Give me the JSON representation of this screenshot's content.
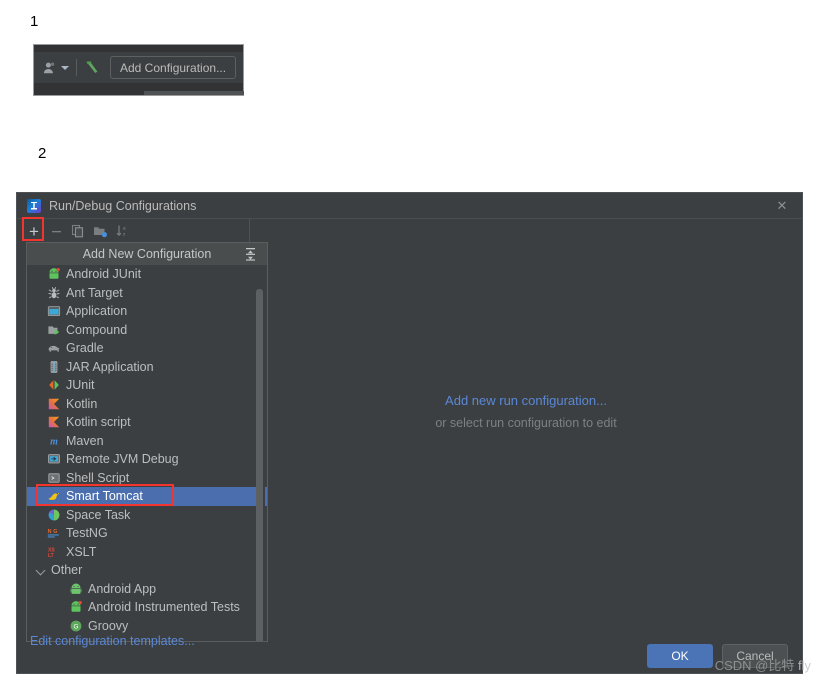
{
  "steps": {
    "one": "1",
    "two": "2"
  },
  "toolbar": {
    "profile_icon": "user-dropdown-icon",
    "build_icon": "hammer-icon",
    "add_configuration_label": "Add Configuration..."
  },
  "dialog": {
    "title": "Run/Debug Configurations",
    "logo_icon": "intellij-idea-logo-icon",
    "close_icon": "close-icon",
    "toolbar_buttons": [
      {
        "name": "add-configuration-button",
        "icon": "plus-icon",
        "glyph": "+",
        "enabled": true
      },
      {
        "name": "remove-configuration-button",
        "icon": "minus-icon",
        "glyph": "–",
        "enabled": false
      },
      {
        "name": "copy-configuration-button",
        "icon": "copy-icon",
        "glyph": "",
        "enabled": false
      },
      {
        "name": "save-configuration-button",
        "icon": "folder-save-icon",
        "glyph": "",
        "enabled": false
      },
      {
        "name": "sort-configurations-button",
        "icon": "sort-alphabetically-icon",
        "glyph": "",
        "enabled": false
      }
    ],
    "center": {
      "link": "Add new run configuration...",
      "hint": "or select run configuration to edit"
    },
    "buttons": [
      {
        "label": "OK",
        "primary": true
      },
      {
        "label": "Cancel",
        "primary": false
      }
    ]
  },
  "popup": {
    "header": "Add New Configuration",
    "header_icon": "expand-collapse-icon",
    "templates_link": "Edit configuration templates...",
    "items": [
      {
        "label": "Android JUnit",
        "icon": "android-junit-icon",
        "type": "item",
        "selected": false
      },
      {
        "label": "Ant Target",
        "icon": "ant-icon",
        "type": "item",
        "selected": false
      },
      {
        "label": "Application",
        "icon": "application-window-icon",
        "type": "item",
        "selected": false
      },
      {
        "label": "Compound",
        "icon": "compound-icon",
        "type": "item",
        "selected": false
      },
      {
        "label": "Gradle",
        "icon": "gradle-elephant-icon",
        "type": "item",
        "selected": false
      },
      {
        "label": "JAR Application",
        "icon": "jar-icon",
        "type": "item",
        "selected": false
      },
      {
        "label": "JUnit",
        "icon": "junit-icon",
        "type": "item",
        "selected": false
      },
      {
        "label": "Kotlin",
        "icon": "kotlin-icon",
        "type": "item",
        "selected": false
      },
      {
        "label": "Kotlin script",
        "icon": "kotlin-icon",
        "type": "item",
        "selected": false
      },
      {
        "label": "Maven",
        "icon": "maven-icon",
        "type": "item",
        "selected": false
      },
      {
        "label": "Remote JVM Debug",
        "icon": "remote-debug-icon",
        "type": "item",
        "selected": false
      },
      {
        "label": "Shell Script",
        "icon": "shell-script-icon",
        "type": "item",
        "selected": false
      },
      {
        "label": "Smart Tomcat",
        "icon": "tomcat-icon",
        "type": "item",
        "selected": true
      },
      {
        "label": "Space Task",
        "icon": "space-task-icon",
        "type": "item",
        "selected": false
      },
      {
        "label": "TestNG",
        "icon": "testng-icon",
        "type": "item",
        "selected": false
      },
      {
        "label": "XSLT",
        "icon": "xslt-icon",
        "type": "item",
        "selected": false
      },
      {
        "label": "Other",
        "icon": "chevron-down-icon",
        "type": "group",
        "selected": false
      },
      {
        "label": "Android App",
        "icon": "android-icon",
        "type": "child",
        "selected": false
      },
      {
        "label": "Android Instrumented Tests",
        "icon": "android-junit-icon",
        "type": "child",
        "selected": false
      },
      {
        "label": "Groovy",
        "icon": "groovy-icon",
        "type": "child",
        "selected": false
      }
    ]
  },
  "annotations": {
    "add_button_box": "red-highlight-box",
    "smart_tomcat_box": "red-highlight-box"
  },
  "watermark": {
    "prefix": "CSDN @比特",
    "suffix": " fly"
  },
  "colors": {
    "dialog_bg": "#3c3f41",
    "selection_blue": "#4b6eaf",
    "link_blue": "#5a88d6",
    "annotation_red": "#f2352f",
    "text_primary": "#bcbec0"
  }
}
